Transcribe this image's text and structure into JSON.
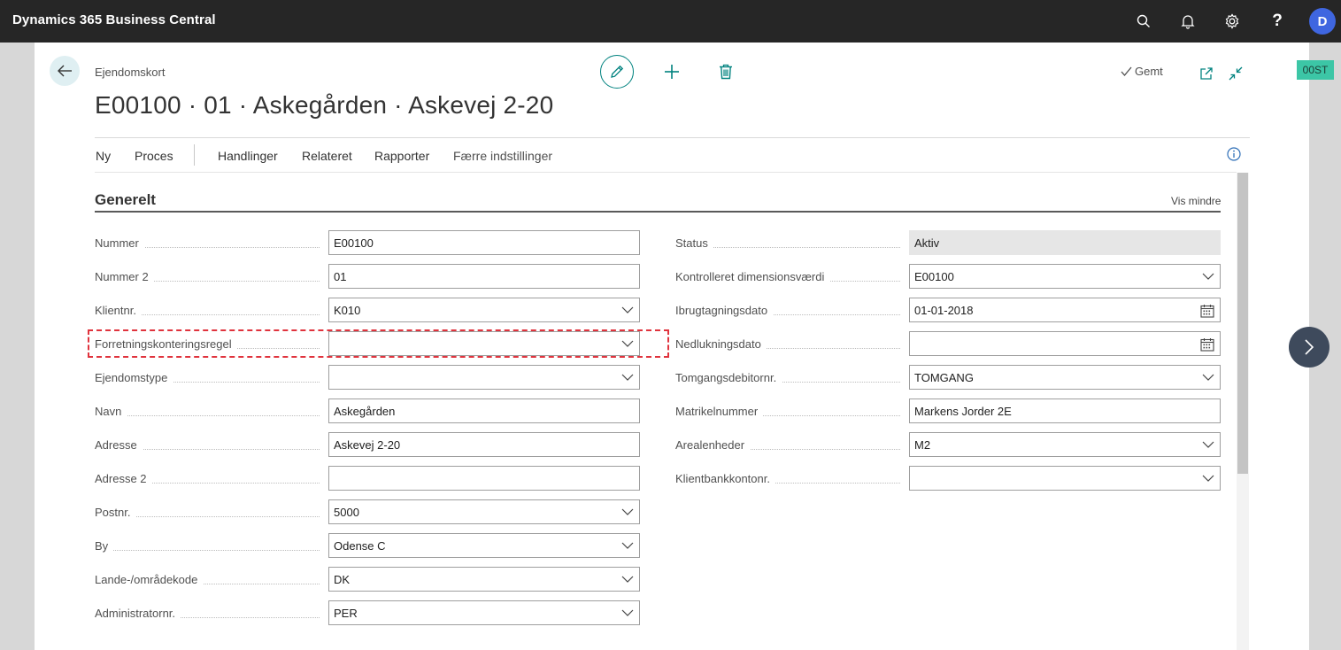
{
  "app": {
    "title": "Dynamics 365 Business Central",
    "user_initial": "D"
  },
  "page": {
    "breadcrumb": "Ejendomskort",
    "title": "E00100 · 01 · Askegården · Askevej 2-20",
    "saved_label": "Gemt",
    "badge": "00ST"
  },
  "menu": {
    "items": [
      "Ny",
      "Proces",
      "Handlinger",
      "Relateret",
      "Rapporter"
    ],
    "fewer_options": "Færre indstillinger"
  },
  "section": {
    "title": "Generelt",
    "show_less": "Vis mindre"
  },
  "left_fields": [
    {
      "label": "Nummer",
      "value": "E00100"
    },
    {
      "label": "Nummer 2",
      "value": "01"
    },
    {
      "label": "Klientnr.",
      "value": "K010"
    },
    {
      "label": "Forretningskonteringsregel",
      "value": ""
    },
    {
      "label": "Ejendomstype",
      "value": ""
    },
    {
      "label": "Navn",
      "value": "Askegården"
    },
    {
      "label": "Adresse",
      "value": "Askevej 2-20"
    },
    {
      "label": "Adresse 2",
      "value": ""
    },
    {
      "label": "Postnr.",
      "value": "5000"
    },
    {
      "label": "By",
      "value": "Odense C"
    },
    {
      "label": "Lande-/områdekode",
      "value": "DK"
    },
    {
      "label": "Administratornr.",
      "value": "PER"
    }
  ],
  "right_fields": [
    {
      "label": "Status",
      "value": "Aktiv"
    },
    {
      "label": "Kontrolleret dimensionsværdi",
      "value": "E00100"
    },
    {
      "label": "Ibrugtagningsdato",
      "value": "01-01-2018"
    },
    {
      "label": "Nedlukningsdato",
      "value": ""
    },
    {
      "label": "Tomgangsdebitornr.",
      "value": "TOMGANG"
    },
    {
      "label": "Matrikelnummer",
      "value": "Markens Jorder 2E"
    },
    {
      "label": "Arealenheder",
      "value": "M2"
    },
    {
      "label": "Klientbankkontonr.",
      "value": ""
    }
  ],
  "colors": {
    "accent": "#00827f",
    "topbar": "#262626",
    "avatar": "#3f66e0",
    "highlight": "#e0333d"
  }
}
